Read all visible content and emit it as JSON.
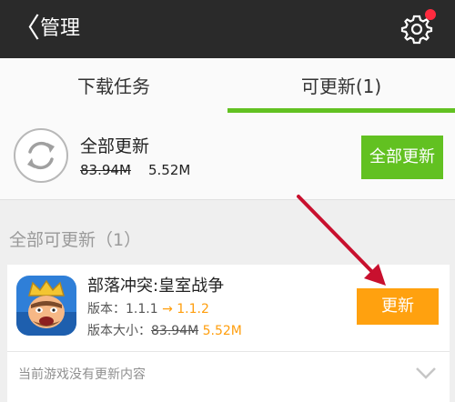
{
  "header": {
    "back_icon": "chevron-left-icon",
    "title": "管理",
    "settings_icon": "gear-icon"
  },
  "tabs": [
    {
      "label": "下载任务"
    },
    {
      "label": "可更新(1)"
    }
  ],
  "update_all": {
    "icon": "refresh-icon",
    "title": "全部更新",
    "old_size": "83.94M",
    "new_size": "5.52M",
    "button": "全部更新"
  },
  "section": {
    "label": "全部可更新（1）"
  },
  "apps": [
    {
      "name": "部落冲突:皇室战争",
      "version_label": "版本：",
      "old_version": "1.1.1",
      "arrow": "→",
      "new_version": "1.1.2",
      "size_label": "版本大小：",
      "old_size": "83.94M",
      "new_size": "5.52M",
      "button": "更新",
      "note": "当前游戏没有更新内容"
    }
  ],
  "colors": {
    "accent_green": "#62c121",
    "accent_orange": "#ffa10f",
    "annotation_red": "#c8102e"
  }
}
